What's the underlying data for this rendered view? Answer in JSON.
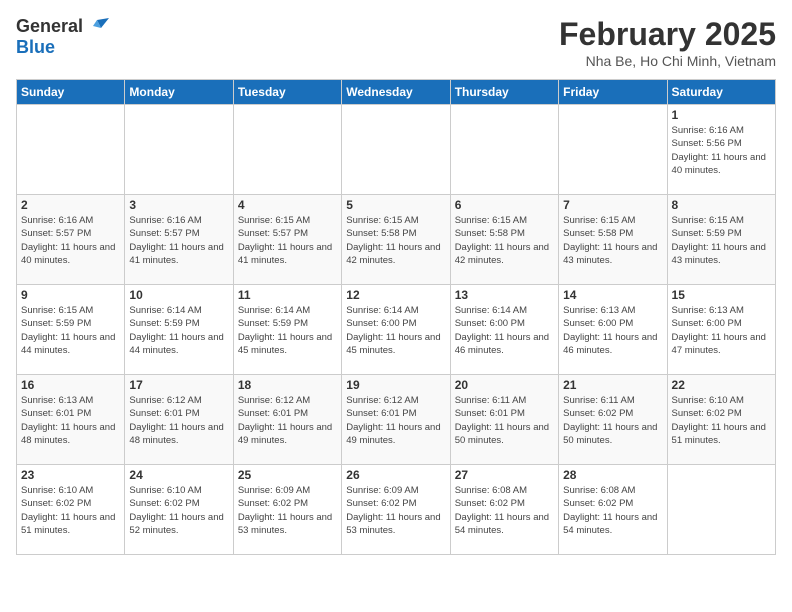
{
  "header": {
    "logo_general": "General",
    "logo_blue": "Blue",
    "title": "February 2025",
    "subtitle": "Nha Be, Ho Chi Minh, Vietnam"
  },
  "weekdays": [
    "Sunday",
    "Monday",
    "Tuesday",
    "Wednesday",
    "Thursday",
    "Friday",
    "Saturday"
  ],
  "weeks": [
    [
      {
        "day": "",
        "info": ""
      },
      {
        "day": "",
        "info": ""
      },
      {
        "day": "",
        "info": ""
      },
      {
        "day": "",
        "info": ""
      },
      {
        "day": "",
        "info": ""
      },
      {
        "day": "",
        "info": ""
      },
      {
        "day": "1",
        "info": "Sunrise: 6:16 AM\nSunset: 5:56 PM\nDaylight: 11 hours\nand 40 minutes."
      }
    ],
    [
      {
        "day": "2",
        "info": "Sunrise: 6:16 AM\nSunset: 5:57 PM\nDaylight: 11 hours\nand 40 minutes."
      },
      {
        "day": "3",
        "info": "Sunrise: 6:16 AM\nSunset: 5:57 PM\nDaylight: 11 hours\nand 41 minutes."
      },
      {
        "day": "4",
        "info": "Sunrise: 6:15 AM\nSunset: 5:57 PM\nDaylight: 11 hours\nand 41 minutes."
      },
      {
        "day": "5",
        "info": "Sunrise: 6:15 AM\nSunset: 5:58 PM\nDaylight: 11 hours\nand 42 minutes."
      },
      {
        "day": "6",
        "info": "Sunrise: 6:15 AM\nSunset: 5:58 PM\nDaylight: 11 hours\nand 42 minutes."
      },
      {
        "day": "7",
        "info": "Sunrise: 6:15 AM\nSunset: 5:58 PM\nDaylight: 11 hours\nand 43 minutes."
      },
      {
        "day": "8",
        "info": "Sunrise: 6:15 AM\nSunset: 5:59 PM\nDaylight: 11 hours\nand 43 minutes."
      }
    ],
    [
      {
        "day": "9",
        "info": "Sunrise: 6:15 AM\nSunset: 5:59 PM\nDaylight: 11 hours\nand 44 minutes."
      },
      {
        "day": "10",
        "info": "Sunrise: 6:14 AM\nSunset: 5:59 PM\nDaylight: 11 hours\nand 44 minutes."
      },
      {
        "day": "11",
        "info": "Sunrise: 6:14 AM\nSunset: 5:59 PM\nDaylight: 11 hours\nand 45 minutes."
      },
      {
        "day": "12",
        "info": "Sunrise: 6:14 AM\nSunset: 6:00 PM\nDaylight: 11 hours\nand 45 minutes."
      },
      {
        "day": "13",
        "info": "Sunrise: 6:14 AM\nSunset: 6:00 PM\nDaylight: 11 hours\nand 46 minutes."
      },
      {
        "day": "14",
        "info": "Sunrise: 6:13 AM\nSunset: 6:00 PM\nDaylight: 11 hours\nand 46 minutes."
      },
      {
        "day": "15",
        "info": "Sunrise: 6:13 AM\nSunset: 6:00 PM\nDaylight: 11 hours\nand 47 minutes."
      }
    ],
    [
      {
        "day": "16",
        "info": "Sunrise: 6:13 AM\nSunset: 6:01 PM\nDaylight: 11 hours\nand 48 minutes."
      },
      {
        "day": "17",
        "info": "Sunrise: 6:12 AM\nSunset: 6:01 PM\nDaylight: 11 hours\nand 48 minutes."
      },
      {
        "day": "18",
        "info": "Sunrise: 6:12 AM\nSunset: 6:01 PM\nDaylight: 11 hours\nand 49 minutes."
      },
      {
        "day": "19",
        "info": "Sunrise: 6:12 AM\nSunset: 6:01 PM\nDaylight: 11 hours\nand 49 minutes."
      },
      {
        "day": "20",
        "info": "Sunrise: 6:11 AM\nSunset: 6:01 PM\nDaylight: 11 hours\nand 50 minutes."
      },
      {
        "day": "21",
        "info": "Sunrise: 6:11 AM\nSunset: 6:02 PM\nDaylight: 11 hours\nand 50 minutes."
      },
      {
        "day": "22",
        "info": "Sunrise: 6:10 AM\nSunset: 6:02 PM\nDaylight: 11 hours\nand 51 minutes."
      }
    ],
    [
      {
        "day": "23",
        "info": "Sunrise: 6:10 AM\nSunset: 6:02 PM\nDaylight: 11 hours\nand 51 minutes."
      },
      {
        "day": "24",
        "info": "Sunrise: 6:10 AM\nSunset: 6:02 PM\nDaylight: 11 hours\nand 52 minutes."
      },
      {
        "day": "25",
        "info": "Sunrise: 6:09 AM\nSunset: 6:02 PM\nDaylight: 11 hours\nand 53 minutes."
      },
      {
        "day": "26",
        "info": "Sunrise: 6:09 AM\nSunset: 6:02 PM\nDaylight: 11 hours\nand 53 minutes."
      },
      {
        "day": "27",
        "info": "Sunrise: 6:08 AM\nSunset: 6:02 PM\nDaylight: 11 hours\nand 54 minutes."
      },
      {
        "day": "28",
        "info": "Sunrise: 6:08 AM\nSunset: 6:02 PM\nDaylight: 11 hours\nand 54 minutes."
      },
      {
        "day": "",
        "info": ""
      }
    ]
  ]
}
